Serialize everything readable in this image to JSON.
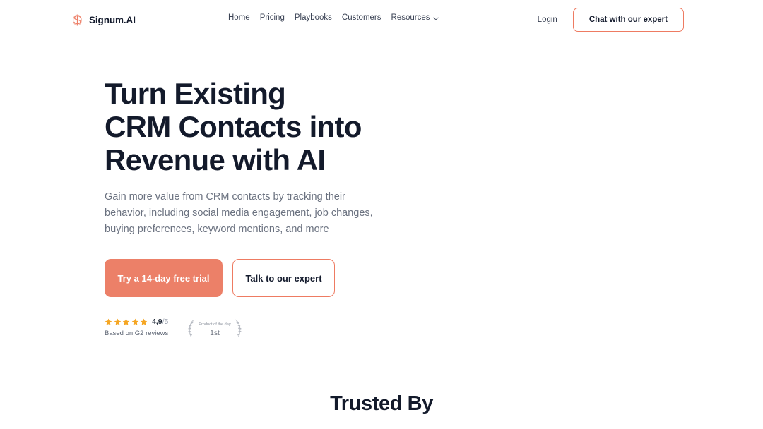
{
  "brand": {
    "name": "Signum.AI",
    "logo_icon": "signum-s-logo-icon",
    "accent_color": "#EC8068"
  },
  "header": {
    "nav": [
      {
        "label": "Home",
        "icon": null
      },
      {
        "label": "Pricing",
        "icon": null
      },
      {
        "label": "Playbooks",
        "icon": null
      },
      {
        "label": "Customers",
        "icon": null
      },
      {
        "label": "Resources",
        "icon": "chevron-down-icon"
      }
    ],
    "login_label": "Login",
    "chat_button_label": "Chat with our expert"
  },
  "hero": {
    "title_lines": [
      "Turn Existing",
      "CRM Contacts into",
      "Revenue with AI"
    ],
    "subtitle": "Gain more value from CRM contacts by tracking their behavior, including social media engagement, job changes, buying preferences, keyword mentions, and more",
    "primary_cta": "Try a 14-day free trial",
    "secondary_cta": "Talk to our expert"
  },
  "social_proof": {
    "star_count": 5,
    "star_color": "#F5A623",
    "score": "4,9",
    "score_suffix": "/5",
    "caption": "Based on G2 reviews",
    "badge": {
      "icon": "laurel-wreath-badge-icon",
      "top_text": "Product of the day",
      "rank_text": "1st"
    }
  },
  "trusted": {
    "title": "Trusted By"
  }
}
